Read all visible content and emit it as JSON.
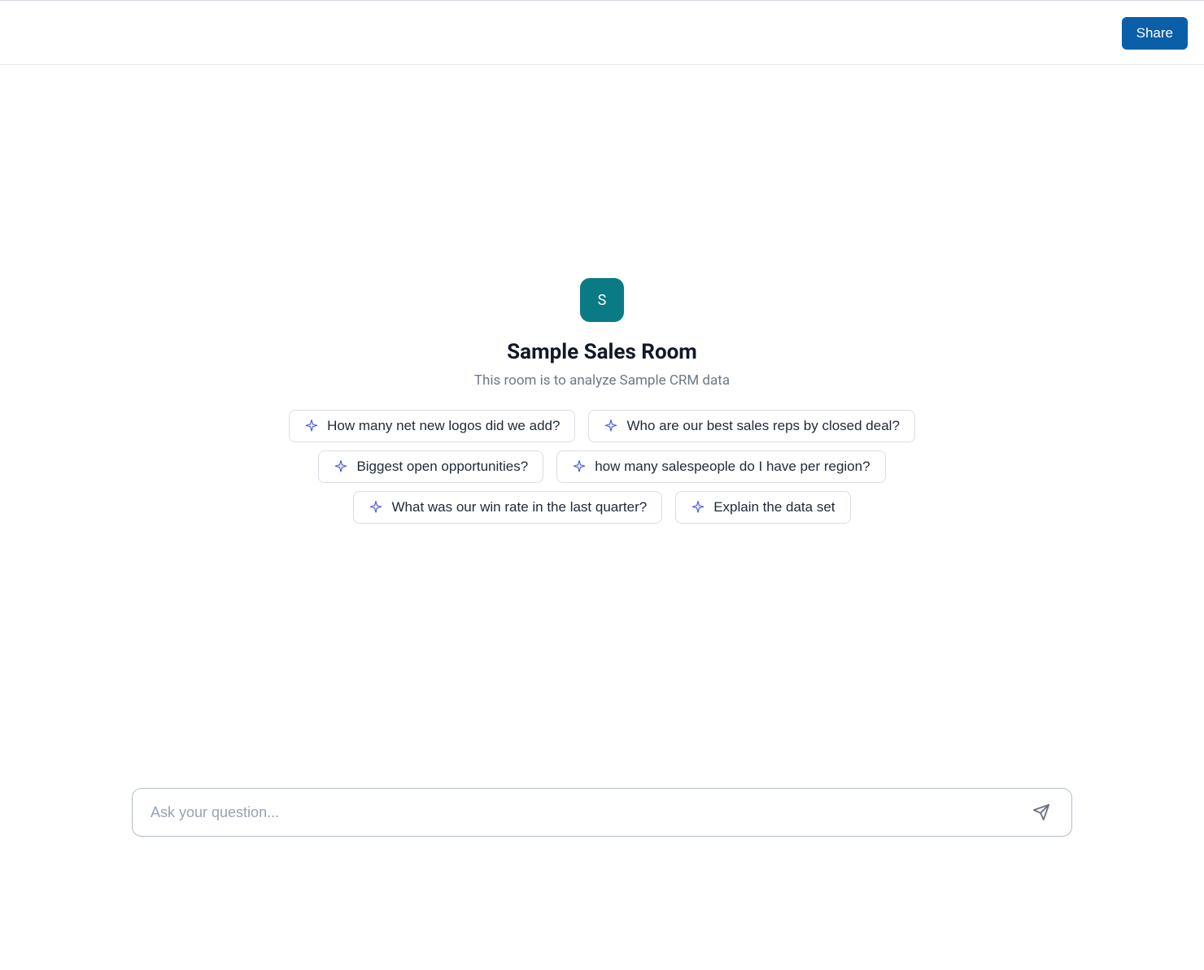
{
  "header": {
    "share_label": "Share"
  },
  "room": {
    "avatar_letter": "S",
    "title": "Sample Sales Room",
    "subtitle": "This room is to analyze Sample CRM data"
  },
  "suggestions": {
    "row1": [
      "How many net new logos did we add?",
      "Who are our best sales reps by closed deal?"
    ],
    "row2": [
      "Biggest open opportunities?",
      "how many salespeople do I have per region?"
    ],
    "row3": [
      "What was our win rate in the last quarter?",
      "Explain the data set"
    ]
  },
  "input": {
    "placeholder": "Ask your question...",
    "value": ""
  },
  "colors": {
    "primary_button": "#0b5ea8",
    "avatar_bg": "#0a7b85"
  }
}
